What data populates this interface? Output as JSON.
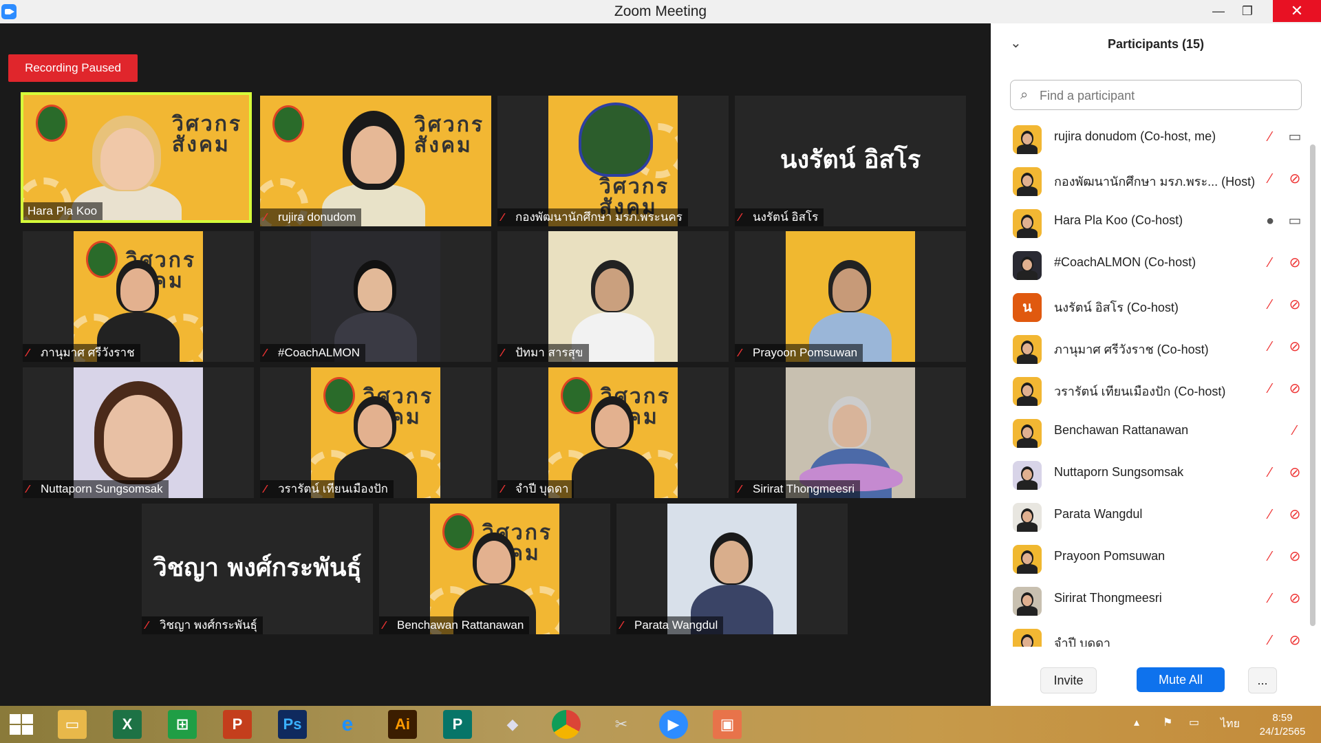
{
  "window": {
    "title": "Zoom Meeting",
    "minimize": "—",
    "restore": "❐",
    "close": "✕"
  },
  "recording": {
    "label": "Recording Paused"
  },
  "tiles": [
    {
      "name": "Hara Pla Koo",
      "big": ""
    },
    {
      "name": "rujira donudom",
      "big": ""
    },
    {
      "name": "กองพัฒนานักศึกษา มรภ.พระนคร",
      "big": ""
    },
    {
      "name": "นงรัตน์ อิสโร",
      "big": "นงรัตน์ อิสโร"
    },
    {
      "name": "ภานุมาศ ศรีวังราช",
      "big": ""
    },
    {
      "name": "#CoachALMON",
      "big": ""
    },
    {
      "name": "ปัทมา สารสุข",
      "big": ""
    },
    {
      "name": "Prayoon Pomsuwan",
      "big": ""
    },
    {
      "name": "Nuttaporn Sungsomsak",
      "big": ""
    },
    {
      "name": "วรารัตน์ เทียนเมืองปัก",
      "big": ""
    },
    {
      "name": "จำปี บุดดา",
      "big": ""
    },
    {
      "name": "Sirirat Thongmeesri",
      "big": ""
    },
    {
      "name": "วิชญา พงศ์กระพันธุ์",
      "big": "วิชญา พงศ์กระพันธุ์"
    },
    {
      "name": "Benchawan Rattanawan",
      "big": ""
    },
    {
      "name": "Parata Wangdul",
      "big": ""
    }
  ],
  "panel": {
    "title": "Participants (15)",
    "search_placeholder": "Find a participant",
    "participants": [
      {
        "name": "rujira donudom (Co-host, me)",
        "avatar_letter": ""
      },
      {
        "name": "กองพัฒนานักศึกษา มรภ.พระ... (Host)",
        "avatar_letter": ""
      },
      {
        "name": "Hara Pla Koo (Co-host)",
        "avatar_letter": ""
      },
      {
        "name": "#CoachALMON (Co-host)",
        "avatar_letter": ""
      },
      {
        "name": "นงรัตน์ อิสโร (Co-host)",
        "avatar_letter": "น"
      },
      {
        "name": "ภานุมาศ ศรีวังราช (Co-host)",
        "avatar_letter": ""
      },
      {
        "name": "วรารัตน์ เทียนเมืองปัก (Co-host)",
        "avatar_letter": ""
      },
      {
        "name": "Benchawan Rattanawan",
        "avatar_letter": ""
      },
      {
        "name": "Nuttaporn Sungsomsak",
        "avatar_letter": ""
      },
      {
        "name": "Parata Wangdul",
        "avatar_letter": ""
      },
      {
        "name": "Prayoon Pomsuwan",
        "avatar_letter": ""
      },
      {
        "name": "Sirirat Thongmeesri",
        "avatar_letter": ""
      },
      {
        "name": "จำปี บุดดา",
        "avatar_letter": ""
      }
    ],
    "invite": "Invite",
    "mute_all": "Mute All",
    "more": "..."
  },
  "poster_text": "วิศวกร\nสังคม",
  "taskbar": {
    "apps": [
      "X",
      "P",
      "Ps",
      "Ai",
      "P"
    ],
    "lang": "ไทย",
    "time": "8:59",
    "date": "24/1/2565"
  },
  "colors": {
    "accent": "#0e72ed",
    "recording": "#e0262c",
    "active_speaker": "#d6ff3a",
    "muted": "#e33333"
  }
}
